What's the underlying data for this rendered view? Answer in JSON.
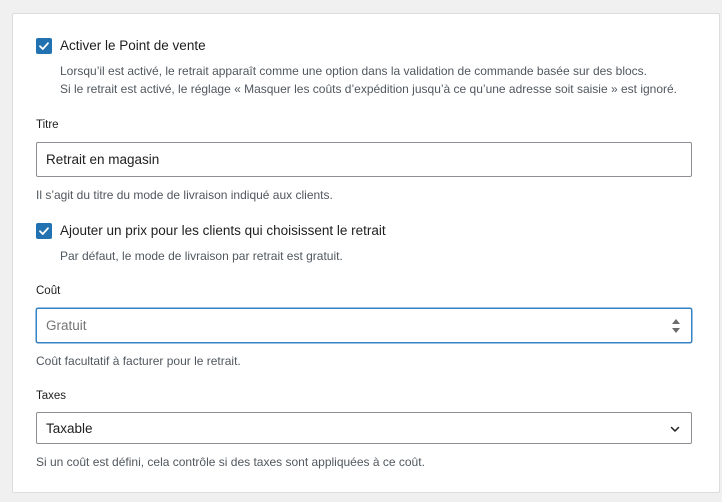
{
  "enable_pickup": {
    "label": "Activer le Point de vente",
    "checked": true,
    "help_line1": "Lorsqu’il est activé, le retrait apparaît comme une option dans la validation de commande basée sur des blocs.",
    "help_line2": "Si le retrait est activé, le réglage « Masquer les coûts d’expédition jusqu’à ce qu’une adresse soit saisie » est ignoré."
  },
  "title_field": {
    "label": "Titre",
    "value": "Retrait en magasin",
    "help": "Il s’agit du titre du mode de livraison indiqué aux clients."
  },
  "add_price": {
    "label": "Ajouter un prix pour les clients qui choisissent le retrait",
    "checked": true,
    "help": "Par défaut, le mode de livraison par retrait est gratuit."
  },
  "cost_field": {
    "label": "Coût",
    "placeholder": "Gratuit",
    "help": "Coût facultatif à facturer pour le retrait."
  },
  "tax_field": {
    "label": "Taxes",
    "selected": "Taxable",
    "help": "Si un coût est défini, cela contrôle si des taxes sont appliquées à ce coût."
  },
  "colors": {
    "accent": "#2271b1",
    "focus_border": "#3582c4",
    "help_text": "#50575e"
  }
}
